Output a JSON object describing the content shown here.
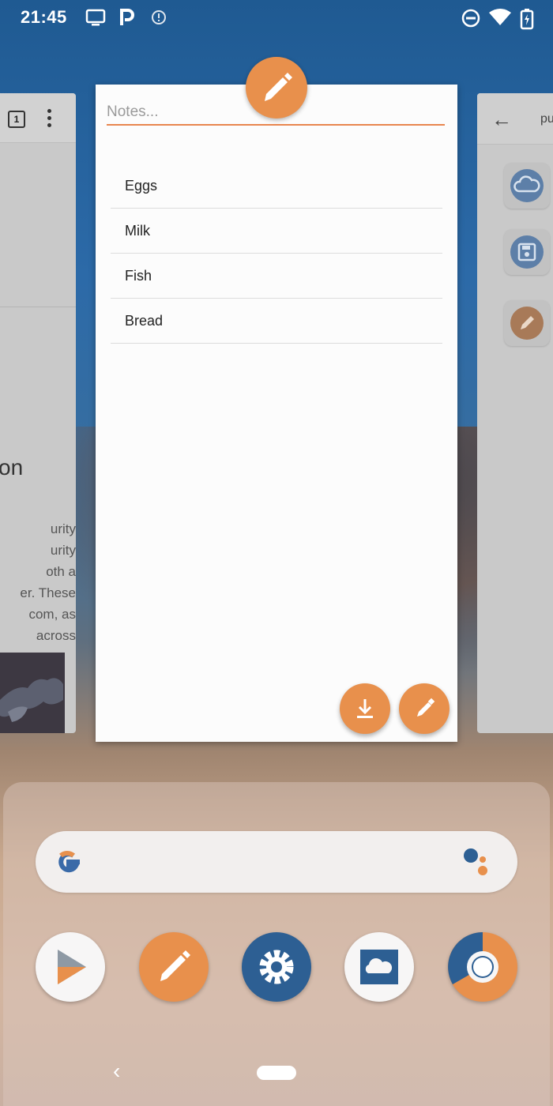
{
  "status_bar": {
    "time": "21:45",
    "left_icons": [
      "tv-icon",
      "p-icon",
      "info-icon"
    ],
    "right_icons": [
      "do-not-disturb-icon",
      "wifi-icon",
      "battery-charging-icon"
    ]
  },
  "left_card": {
    "tab_count": "1",
    "heading_fragment": "on",
    "paragraph_fragments": [
      "urity",
      "urity",
      "oth a",
      "er. These",
      "com, as",
      "across"
    ]
  },
  "right_card": {
    "title_fragment": "pu",
    "buttons": [
      "cloud-icon",
      "save-icon",
      "pencil-icon"
    ]
  },
  "notes_app": {
    "input_placeholder": "Notes...",
    "input_value": "",
    "items": [
      {
        "label": "Eggs"
      },
      {
        "label": "Milk"
      },
      {
        "label": "Fish"
      },
      {
        "label": "Bread"
      }
    ],
    "fabs": [
      "download-icon",
      "pencil-icon"
    ]
  },
  "dock": {
    "search_placeholder": "",
    "apps": [
      "play-store",
      "notes",
      "settings",
      "cloud-photos",
      "chrome"
    ]
  },
  "colors": {
    "accent": "#e8904c",
    "settings_blue": "#2d5f93"
  }
}
